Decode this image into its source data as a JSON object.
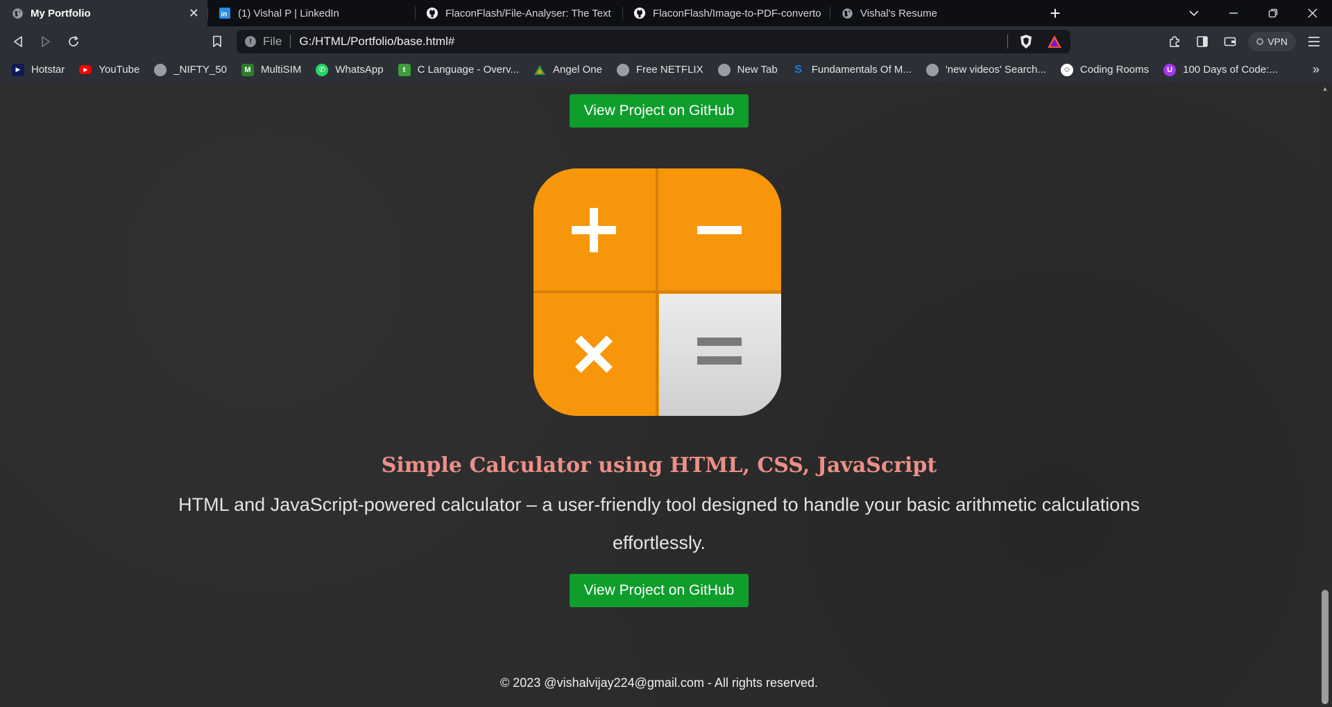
{
  "browser": {
    "tabs": [
      {
        "title": "My Portfolio",
        "icon": "globe-icon",
        "active": true
      },
      {
        "title": "(1) Vishal P | LinkedIn",
        "icon": "linkedin-icon"
      },
      {
        "title": "FlaconFlash/File-Analyser: The Text File",
        "icon": "github-icon"
      },
      {
        "title": "FlaconFlash/Image-to-PDF-convertor-",
        "icon": "github-icon"
      },
      {
        "title": "Vishal's Resume",
        "icon": "globe-icon"
      }
    ],
    "address": {
      "scheme": "File",
      "url": "G:/HTML/Portfolio/base.html#"
    },
    "vpn_label": "VPN",
    "bookmarks": [
      {
        "label": "Hotstar",
        "icon": "hotstar-icon",
        "color": "#1a2a6c"
      },
      {
        "label": "YouTube",
        "icon": "youtube-icon",
        "color": "#ff0000"
      },
      {
        "label": "_NIFTY_50",
        "icon": "globe-icon",
        "color": "#9a9da4"
      },
      {
        "label": "MultiSIM",
        "icon": "multisim-icon",
        "color": "#3c8d2f"
      },
      {
        "label": "WhatsApp",
        "icon": "whatsapp-icon",
        "color": "#25d366"
      },
      {
        "label": "C Language - Overv...",
        "icon": "tutorialspoint-icon",
        "color": "#3c9d3a"
      },
      {
        "label": "Angel One",
        "icon": "angelone-icon",
        "color": "#2f9e44"
      },
      {
        "label": "Free NETFLIX",
        "icon": "globe-icon",
        "color": "#9a9da4"
      },
      {
        "label": "New Tab",
        "icon": "globe-icon",
        "color": "#9a9da4"
      },
      {
        "label": "Fundamentals Of M...",
        "icon": "scribd-icon",
        "color": "#1e7bd8"
      },
      {
        "label": "'new videos' Search...",
        "icon": "globe-icon",
        "color": "#9a9da4"
      },
      {
        "label": "Coding Rooms",
        "icon": "codingrooms-icon",
        "color": "#ffffff"
      },
      {
        "label": "100 Days of Code:...",
        "icon": "udemy-icon",
        "color": "#a435f0"
      }
    ]
  },
  "page": {
    "github_button_top": "View Project on GitHub",
    "project": {
      "icon": "calculator-icon",
      "title": "Simple Calculator using HTML, CSS, JavaScript",
      "description": "HTML and JavaScript-powered calculator – a user-friendly tool designed to handle your basic arithmetic calculations effortlessly.",
      "button": "View Project on GitHub"
    },
    "footer": "© 2023 @vishalvijay224@gmail.com - All rights reserved."
  },
  "colors": {
    "button_green": "#0f9d2c",
    "title_salmon": "#ec8f88",
    "calc_orange": "#f7960b",
    "page_bg": "#2c2c2c"
  }
}
